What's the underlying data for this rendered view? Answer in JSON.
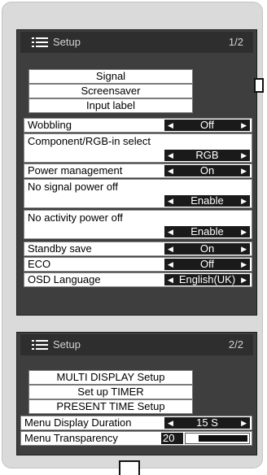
{
  "menu1": {
    "title": "Setup",
    "page": "1/2",
    "buttons": [
      "Signal",
      "Screensaver",
      "Input label"
    ],
    "rows": [
      {
        "label": "Wobbling",
        "value": "Off"
      },
      {
        "label": "Component/RGB-in select",
        "value": "RGB"
      },
      {
        "label": "Power management",
        "value": "On"
      },
      {
        "label": "No signal power off",
        "value": "Enable"
      },
      {
        "label": "No activity power off",
        "value": "Enable"
      },
      {
        "label": "Standby save",
        "value": "On"
      },
      {
        "label": "ECO",
        "value": "Off"
      },
      {
        "label": "OSD Language",
        "value": "English(UK)"
      }
    ]
  },
  "menu2": {
    "title": "Setup",
    "page": "2/2",
    "buttons": [
      "MULTI DISPLAY Setup",
      "Set up TIMER",
      "PRESENT TIME Setup"
    ],
    "rows": [
      {
        "label": "Menu Display Duration",
        "value": "15 S"
      },
      {
        "label": "Menu Transparency",
        "value": "20",
        "level_percent": 20
      }
    ]
  },
  "icons": {
    "setup_icon": "menu-list-icon",
    "left_arrow": "◀",
    "right_arrow": "▶"
  }
}
